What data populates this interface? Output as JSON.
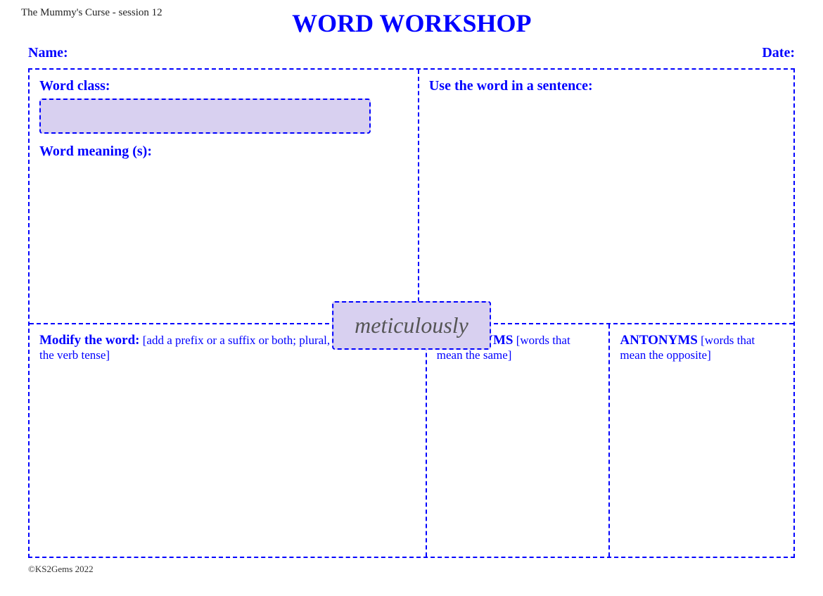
{
  "header": {
    "session_title": "The Mummy's Curse - session 12",
    "page_title": "WORD WORKSHOP",
    "name_label": "Name:",
    "date_label": "Date:"
  },
  "left_panel": {
    "word_class_label": "Word class:",
    "word_meaning_label": "Word meaning (s):"
  },
  "right_panel": {
    "use_word_label": "Use the word in a sentence:"
  },
  "featured_word": "meticulously",
  "bottom": {
    "modify_label_bold": "Modify the word:",
    "modify_label_normal": " [add a prefix or a suffix or both; plural, singular; change the verb tense]",
    "synonyms_label_bold": "SYNONYMS",
    "synonyms_label_normal": " [words that mean the same]",
    "antonyms_label_bold": "ANTONYMS",
    "antonyms_label_normal": " [words that mean the opposite]"
  },
  "footer": {
    "copyright": "©KS2Gems 2022"
  }
}
